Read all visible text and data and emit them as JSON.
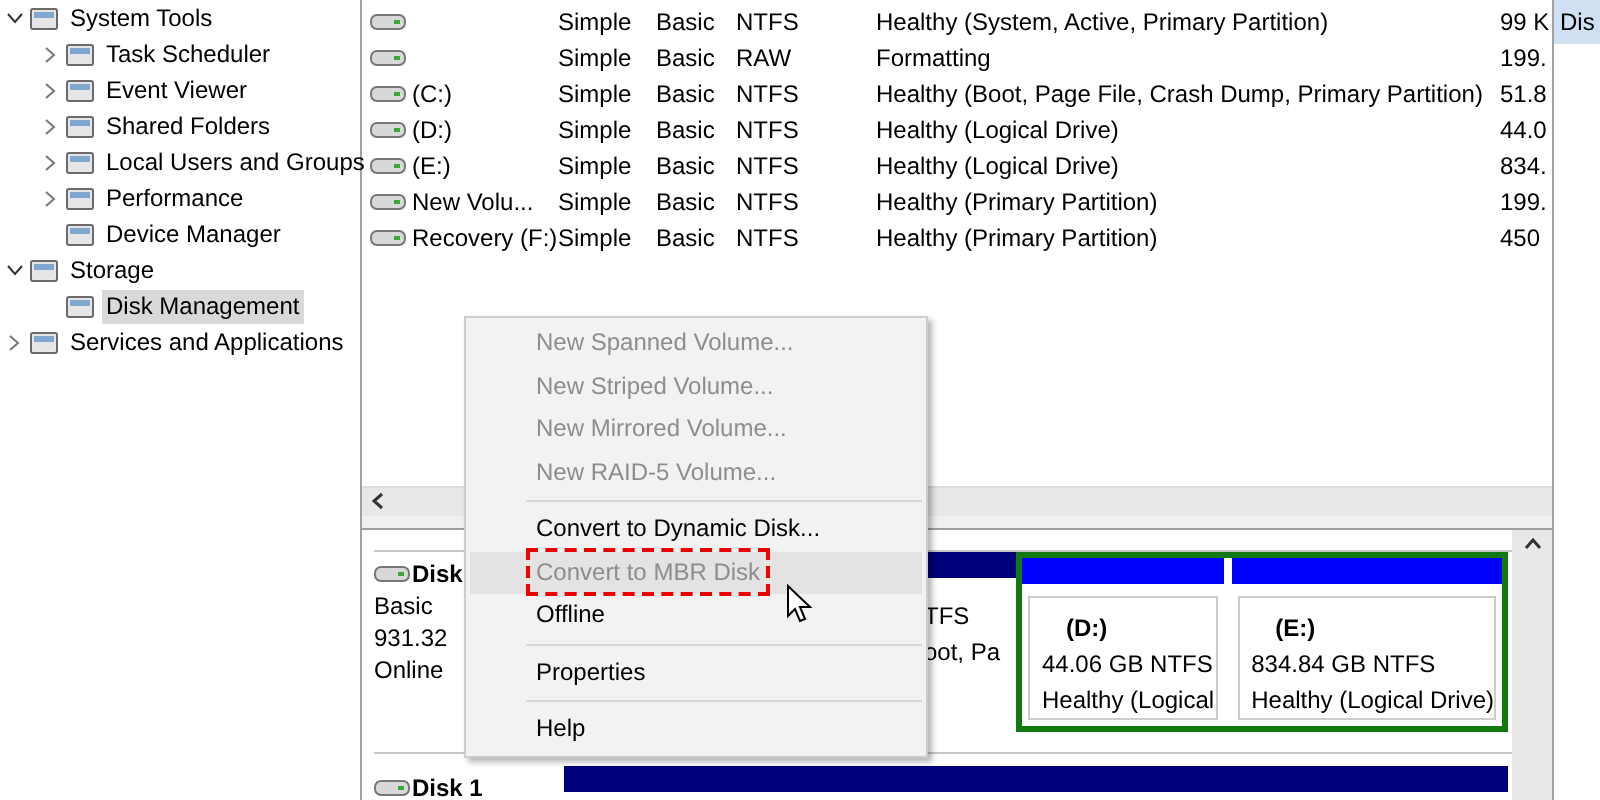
{
  "tree": [
    {
      "label": "System Tools",
      "expanded": true,
      "selected": false,
      "children": [
        {
          "label": "Task Scheduler",
          "expanded": false,
          "selected": false
        },
        {
          "label": "Event Viewer",
          "expanded": false,
          "selected": false
        },
        {
          "label": "Shared Folders",
          "expanded": false,
          "selected": false
        },
        {
          "label": "Local Users and Groups",
          "expanded": false,
          "selected": false
        },
        {
          "label": "Performance",
          "expanded": false,
          "selected": false
        },
        {
          "label": "Device Manager",
          "selected": false
        }
      ]
    },
    {
      "label": "Storage",
      "expanded": true,
      "selected": false,
      "children": [
        {
          "label": "Disk Management",
          "selected": true
        }
      ]
    },
    {
      "label": "Services and Applications",
      "expanded": false,
      "selected": false
    }
  ],
  "volumes": [
    {
      "layout": "Simple",
      "type": "Basic",
      "file_system": "NTFS",
      "status": "Healthy (System, Active, Primary Partition)",
      "capacity": "99 K"
    },
    {
      "layout": "Simple",
      "type": "Basic",
      "file_system": "RAW",
      "status": "Formatting",
      "capacity": "199."
    },
    {
      "volume": "(C:)",
      "layout": "Simple",
      "type": "Basic",
      "file_system": "NTFS",
      "status": "Healthy (Boot, Page File, Crash Dump, Primary Partition)",
      "capacity": "51.8"
    },
    {
      "volume": "(D:)",
      "layout": "Simple",
      "type": "Basic",
      "file_system": "NTFS",
      "status": "Healthy (Logical Drive)",
      "capacity": "44.0"
    },
    {
      "volume": "(E:)",
      "layout": "Simple",
      "type": "Basic",
      "file_system": "NTFS",
      "status": "Healthy (Logical Drive)",
      "capacity": "834."
    },
    {
      "volume": "New Volu...",
      "layout": "Simple",
      "type": "Basic",
      "file_system": "NTFS",
      "status": "Healthy (Primary Partition)",
      "capacity": "199."
    },
    {
      "volume": "Recovery (F:)",
      "layout": "Simple",
      "type": "Basic",
      "file_system": "NTFS",
      "status": "Healthy (Primary Partition)",
      "capacity": "450"
    }
  ],
  "disks": [
    {
      "name": "Disk",
      "lines": [
        "Basic",
        "931.32",
        "Online"
      ],
      "partitions": [
        {
          "kind": "primary",
          "lines": [
            "TFS",
            "oot, Pa"
          ]
        },
        {
          "kind": "extended",
          "children": [
            {
              "kind": "logical",
              "title": "(D:)",
              "lines": [
                "44.06 GB NTFS",
                "Healthy (Logical"
              ]
            },
            {
              "kind": "logical",
              "title": "(E:)",
              "lines": [
                "834.84 GB NTFS",
                "Healthy (Logical Drive)"
              ]
            }
          ]
        }
      ]
    },
    {
      "name": "Disk 1",
      "partitions": [
        {
          "kind": "primary"
        }
      ]
    }
  ],
  "context_menu": [
    {
      "kind": "item",
      "label": "New Spanned Volume...",
      "disabled": true,
      "selected": false,
      "highlighted": false
    },
    {
      "kind": "item",
      "label": "New Striped Volume...",
      "disabled": true,
      "selected": false,
      "highlighted": false
    },
    {
      "kind": "item",
      "label": "New Mirrored Volume...",
      "disabled": true,
      "selected": false,
      "highlighted": false
    },
    {
      "kind": "item",
      "label": "New RAID-5 Volume...",
      "disabled": true,
      "selected": false,
      "highlighted": false
    },
    {
      "kind": "separator"
    },
    {
      "kind": "item",
      "label": "Convert to Dynamic Disk...",
      "disabled": false,
      "selected": false,
      "highlighted": false
    },
    {
      "kind": "item",
      "label": "Convert to MBR Disk",
      "disabled": true,
      "selected": true,
      "highlighted": true
    },
    {
      "kind": "item",
      "label": "Offline",
      "disabled": false,
      "selected": false,
      "highlighted": false
    },
    {
      "kind": "separator"
    },
    {
      "kind": "item",
      "label": "Properties",
      "disabled": false,
      "selected": false,
      "highlighted": false
    },
    {
      "kind": "separator"
    },
    {
      "kind": "item",
      "label": "Help",
      "disabled": false,
      "selected": false,
      "highlighted": false
    }
  ],
  "actions_pane": {
    "title": "Dis"
  }
}
